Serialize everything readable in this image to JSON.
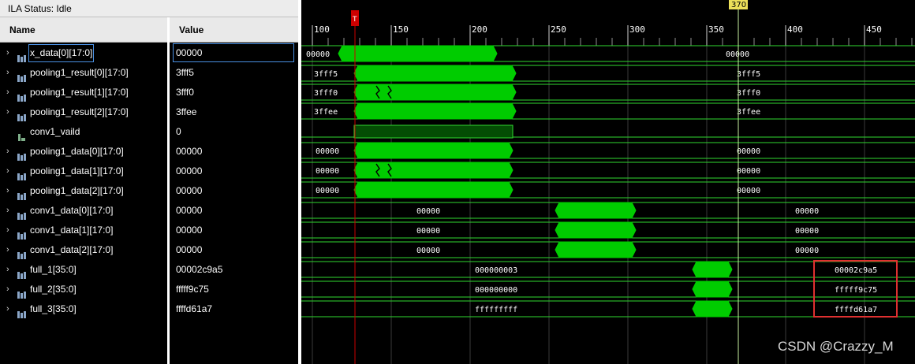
{
  "status": {
    "label": "ILA Status:",
    "state": "Idle"
  },
  "columns": {
    "name": "Name",
    "value": "Value"
  },
  "signals": [
    {
      "name": "x_data[0][17:0]",
      "value": "00000",
      "type": "bus",
      "wave_left": "00000",
      "wave_right": "00000"
    },
    {
      "name": "pooling1_result[0][17:0]",
      "value": "3fff5",
      "type": "bus",
      "wave_left": "3fff5",
      "wave_right": "3fff5"
    },
    {
      "name": "pooling1_result[1][17:0]",
      "value": "3fff0",
      "type": "bus",
      "wave_left": "3fff0",
      "wave_right": "3fff0"
    },
    {
      "name": "pooling1_result[2][17:0]",
      "value": "3ffee",
      "type": "bus",
      "wave_left": "3ffee",
      "wave_right": "3ffee"
    },
    {
      "name": "conv1_vaild",
      "value": "0",
      "type": "bit",
      "wave_left": "",
      "wave_right": ""
    },
    {
      "name": "pooling1_data[0][17:0]",
      "value": "00000",
      "type": "bus",
      "wave_left": "00000",
      "wave_right": "00000"
    },
    {
      "name": "pooling1_data[1][17:0]",
      "value": "00000",
      "type": "bus",
      "wave_left": "00000",
      "wave_right": "00000"
    },
    {
      "name": "pooling1_data[2][17:0]",
      "value": "00000",
      "type": "bus",
      "wave_left": "00000",
      "wave_right": "00000"
    },
    {
      "name": "conv1_data[0][17:0]",
      "value": "00000",
      "type": "bus",
      "wave_left": "00000",
      "wave_right": "00000"
    },
    {
      "name": "conv1_data[1][17:0]",
      "value": "00000",
      "type": "bus",
      "wave_left": "00000",
      "wave_right": "00000"
    },
    {
      "name": "conv1_data[2][17:0]",
      "value": "00000",
      "type": "bus",
      "wave_left": "00000",
      "wave_right": "00000"
    },
    {
      "name": "full_1[35:0]",
      "value": "00002c9a5",
      "type": "bus",
      "wave_left": "000000003",
      "wave_right": "00002c9a5"
    },
    {
      "name": "full_2[35:0]",
      "value": "fffff9c75",
      "type": "bus",
      "wave_left": "000000000",
      "wave_right": "fffff9c75"
    },
    {
      "name": "full_3[35:0]",
      "value": "ffffd61a7",
      "type": "bus",
      "wave_left": "fffffffff",
      "wave_right": "ffffd61a7"
    }
  ],
  "timeline": {
    "ticks": [
      "100",
      "150",
      "200",
      "250",
      "300",
      "350",
      "400",
      "450"
    ],
    "cursor_label": "370",
    "trigger_label": "T"
  },
  "colors": {
    "active": "#00cc00",
    "idle_line": "#2fd82f",
    "cursor": "#c8f0a0",
    "trigger": "#cc0000",
    "highlight": "#e03030"
  },
  "watermark": "CSDN @Crazzy_M"
}
